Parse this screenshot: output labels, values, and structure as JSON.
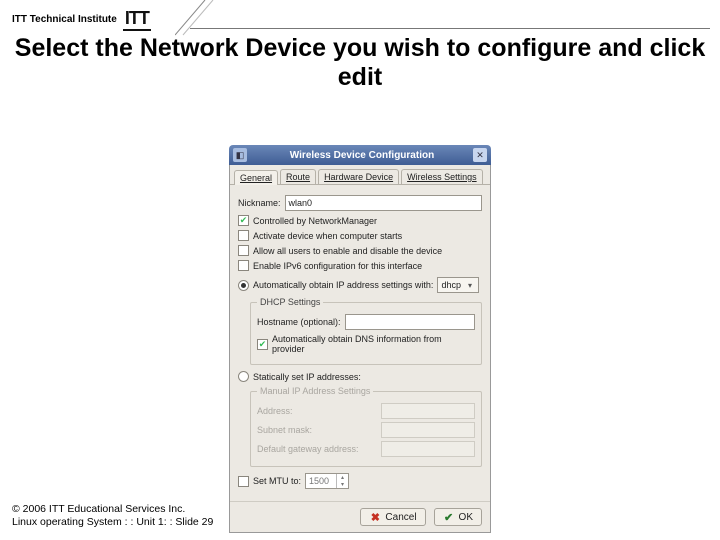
{
  "header": {
    "brand_text": "ITT Technical Institute",
    "logo": "ITT"
  },
  "title": "Select the Network Device you wish to configure and click edit",
  "dialog": {
    "window_title": "Wireless Device Configuration",
    "tabs": [
      {
        "label": "General",
        "accel": "G"
      },
      {
        "label": "Route",
        "accel": "R"
      },
      {
        "label": "Hardware Device",
        "accel": "H"
      },
      {
        "label": "Wireless Settings",
        "accel": "W"
      }
    ],
    "nickname_label": "Nickname:",
    "nickname_value": "wlan0",
    "cb_networkmanager": "Controlled by NetworkManager",
    "cb_activate": "Activate device when computer starts",
    "cb_allow_users": "Allow all users to enable and disable the device",
    "cb_ipv6": "Enable IPv6 configuration for this interface",
    "radio_auto_label": "Automatically obtain IP address settings with:",
    "auto_select_value": "dhcp",
    "dhcp_legend": "DHCP Settings",
    "hostname_label": "Hostname (optional):",
    "cb_dns": "Automatically obtain DNS information from provider",
    "radio_static_label": "Statically set IP addresses:",
    "manual_legend": "Manual IP Address Settings",
    "addr_label": "Address:",
    "mask_label": "Subnet mask:",
    "gw_label": "Default gateway address:",
    "cb_mtu": "Set MTU to:",
    "mtu_value": "1500",
    "btn_cancel": "Cancel",
    "btn_ok": "OK"
  },
  "footer": {
    "line1": "© 2006 ITT Educational Services Inc.",
    "line2": "Linux operating System : : Unit 1: : Slide 29"
  }
}
